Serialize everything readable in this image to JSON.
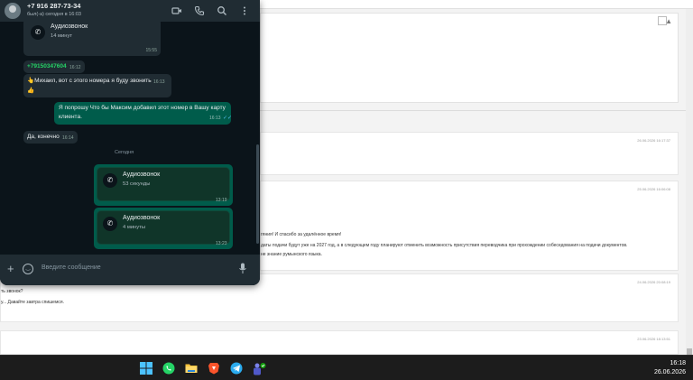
{
  "whatsapp": {
    "contact_name": "+7 916 287-73-34",
    "contact_status": "был(-а) сегодня в 16:03",
    "header_icons": [
      "video-icon",
      "phone-icon",
      "search-icon",
      "more-vert-icon"
    ],
    "messages": {
      "call1": {
        "title": "Аудиозвонок",
        "sub": "14 минут",
        "time": "15:55"
      },
      "phone_msg": {
        "text": "+79150347604",
        "time": "16:12"
      },
      "mikhail": {
        "text": "👆Михаил, вот с этого номера я буду звонить",
        "emoji": "👍",
        "time": "16:13"
      },
      "request": {
        "line1": "Я попрошу Что бы Максим добавил этот номер в Вашу карту",
        "line2": "клиента.",
        "time": "16:13"
      },
      "yes": {
        "text": "Да, конечно",
        "time": "16:14"
      },
      "day_sep": "Сегодня",
      "call2": {
        "title": "Аудиозвонок",
        "sub": "53 секунды",
        "time": "13:19"
      },
      "call3": {
        "title": "Аудиозвонок",
        "sub": "4 минуты",
        "time": "13:23"
      }
    },
    "composer_placeholder": "Введите сообщение"
  },
  "background": {
    "card_dates": [
      "26.06.2026 16:17:37",
      "25.06.2026 16:06:08",
      "24.06.2026 20:08:19",
      "23.06.2026 18:13:51"
    ],
    "lines": [
      "гяния! И спасибо за удалённое время!",
      "даты подачи будут уже на 2027 год, а в следующем году планируют отменить возможность присутствия переводчика при прохождении собеседования на подачи документов.",
      "не знание румынского языка.",
      "ть звонок?",
      "у... Давайте завтра спишемся."
    ]
  },
  "taskbar": {
    "apps": [
      "windows-start-icon",
      "whatsapp-icon",
      "file-explorer-icon",
      "brave-icon",
      "telegram-icon",
      "teams-icon"
    ],
    "time": "16:18",
    "date": "26.06.2026"
  },
  "colors": {
    "wa_bg": "#0b141a",
    "wa_header": "#202c33",
    "bubble_out": "#005c4b",
    "call_card": "#103529",
    "accent_green": "#25d366"
  }
}
